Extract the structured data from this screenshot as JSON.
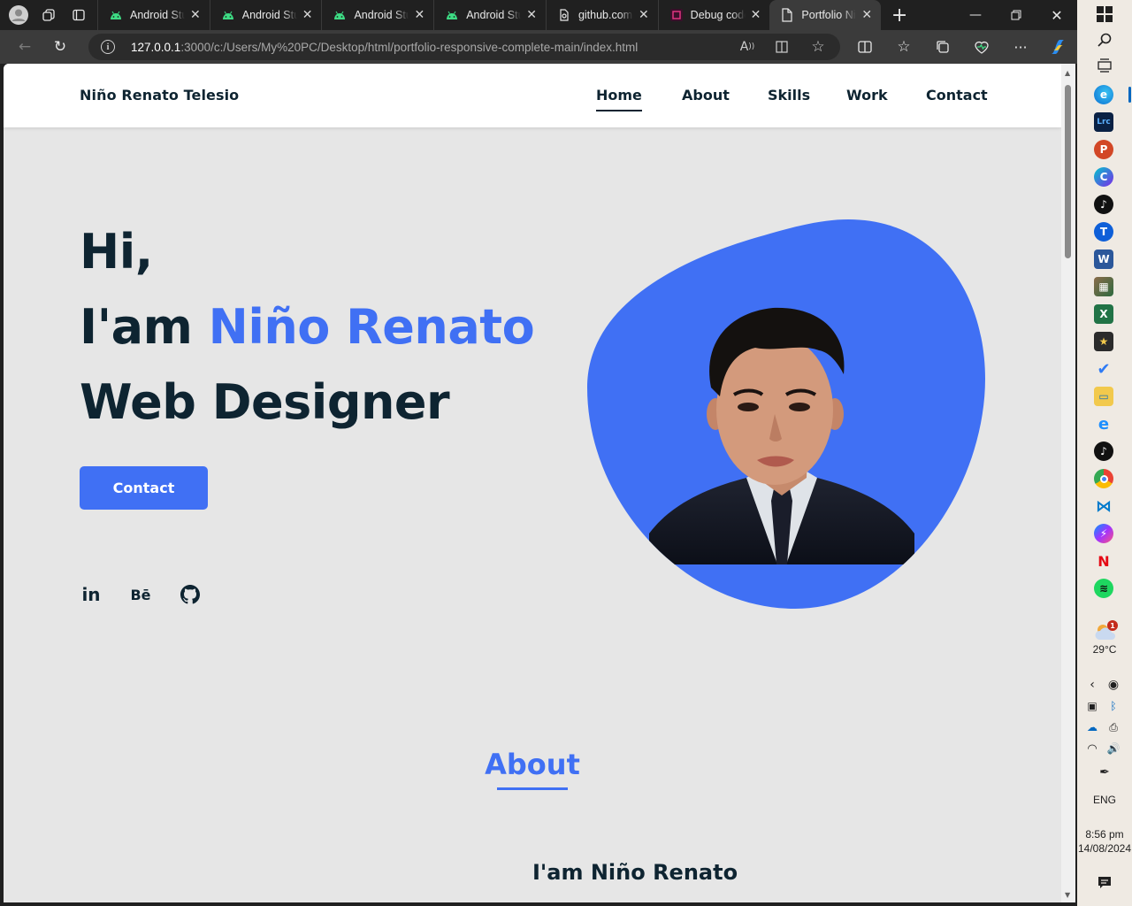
{
  "browser": {
    "tabs": [
      {
        "title": "Android Studio",
        "icon": "android-icon"
      },
      {
        "title": "Android Studio",
        "icon": "android-icon"
      },
      {
        "title": "Android Studio",
        "icon": "android-icon"
      },
      {
        "title": "Android Studio",
        "icon": "android-icon"
      },
      {
        "title": "github.com",
        "icon": "github-page-icon"
      },
      {
        "title": "Debug code",
        "icon": "debug-app-icon"
      },
      {
        "title": "Portfolio Niño",
        "icon": "page-icon",
        "active": true
      }
    ],
    "url_host": "127.0.0.1",
    "url_rest": ":3000/c:/Users/My%20PC/Desktop/html/portfolio-responsive-complete-main/index.html"
  },
  "site": {
    "brand": "Niño Renato Telesio",
    "nav": [
      "Home",
      "About",
      "Skills",
      "Work",
      "Contact"
    ],
    "active_nav": "Home",
    "hero": {
      "line1": "Hi,",
      "line2_prefix": "I'am ",
      "line2_highlight": "Niño Renato",
      "line3": "Web Designer",
      "button": "Contact"
    },
    "social": [
      "linkedin-icon",
      "behance-icon",
      "github-icon"
    ],
    "social_labels": {
      "linkedin": "in",
      "behance": "Bē"
    },
    "about_title": "About",
    "about_subtitle": "I'am Niño Renato",
    "accent_color": "#4070f4",
    "text_color": "#0e2431"
  },
  "taskbar": {
    "weather_temp": "29°C",
    "weather_badge": "1",
    "language": "ENG",
    "time": "8:56 pm",
    "date": "14/08/2024"
  }
}
